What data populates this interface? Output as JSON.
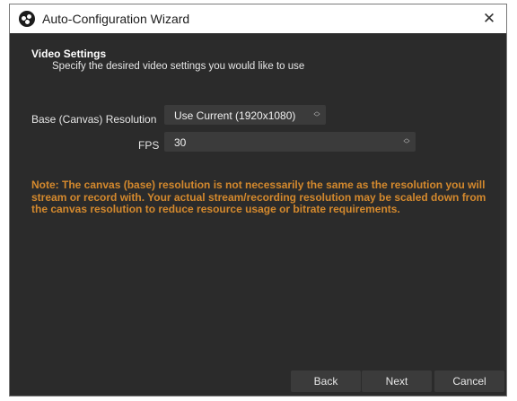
{
  "window": {
    "title": "Auto-Configuration Wizard",
    "close_glyph": "✕"
  },
  "page": {
    "heading": "Video Settings",
    "subheading": "Specify the desired video settings you would like to use"
  },
  "form": {
    "resolution_label": "Base (Canvas) Resolution",
    "resolution_value": "Use Current (1920x1080)",
    "fps_label": "FPS",
    "fps_value": "30"
  },
  "note": "Note: The canvas (base) resolution is not necessarily the same as the resolution you will stream or record with. Your actual stream/recording resolution may be scaled down from the canvas resolution to reduce resource usage or bitrate requirements.",
  "buttons": {
    "back": "Back",
    "next": "Next",
    "cancel": "Cancel"
  },
  "colors": {
    "background": "#2b2b2b",
    "note_text": "#d4892d",
    "control_bg": "#3b3b3b"
  },
  "icons": {
    "app": "obs-logo-icon",
    "close": "close-icon",
    "spinner": "up-down-chevron-icon"
  }
}
